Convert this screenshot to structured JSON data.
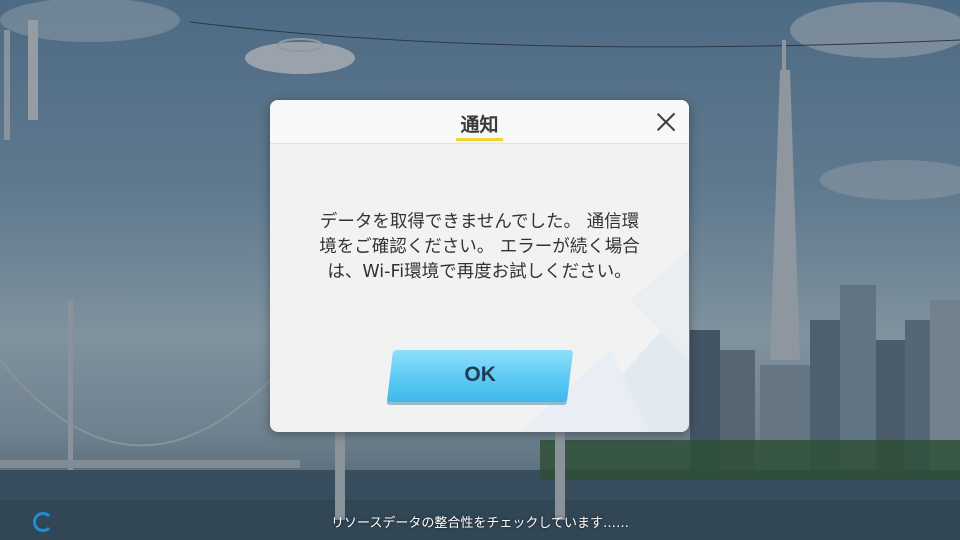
{
  "dialog": {
    "title": "通知",
    "message": "データを取得できませんでした。 通信環\n境をご確認ください。 エラーが続く場合\nは、Wi-Fi環境で再度お試しください。",
    "ok_label": "OK"
  },
  "footer": {
    "status": "リソースデータの整合性をチェックしています……"
  },
  "colors": {
    "accent_underline": "#f2d434",
    "ok_button": "#5ccaf4",
    "spinner": "#1d8fd6"
  },
  "icons": {
    "close": "close-icon",
    "loading": "loading-spinner-icon"
  }
}
